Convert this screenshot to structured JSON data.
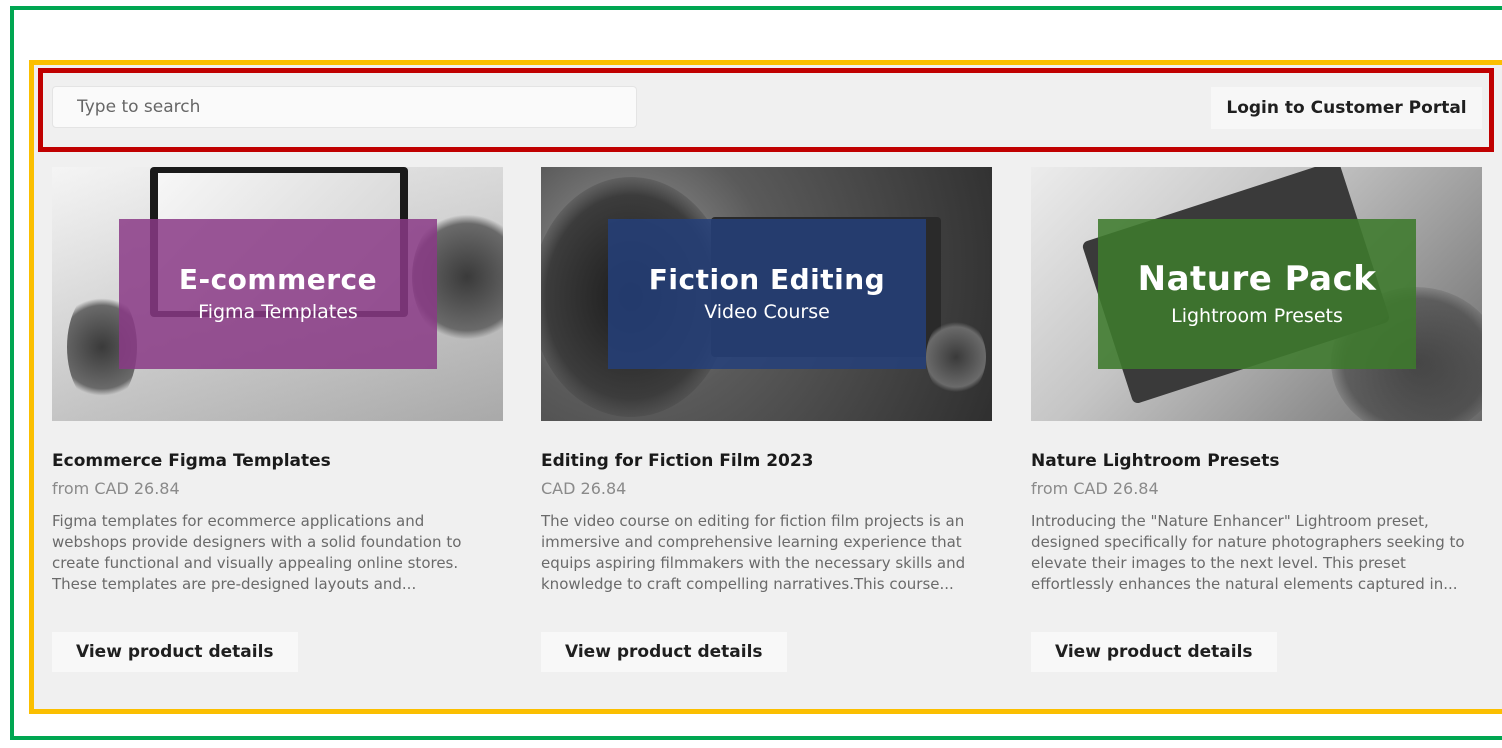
{
  "header": {
    "search_placeholder": "Type to search",
    "login_label": "Login to Customer Portal"
  },
  "products": [
    {
      "banner_title": "E-commerce",
      "banner_subtitle": "Figma Templates",
      "banner_color": "#8a3a86",
      "name": "Ecommerce Figma Templates",
      "price": "from CAD 26.84",
      "description": "Figma templates for ecommerce applications and webshops provide designers with a solid foundation to create functional and visually appealing online stores. These templates are pre-designed layouts and...",
      "button_label": "View product details"
    },
    {
      "banner_title": "Fiction Editing",
      "banner_subtitle": "Video Course",
      "banner_color": "#243f7a",
      "name": "Editing for Fiction Film 2023",
      "price": "CAD 26.84",
      "description": "The video course on editing for fiction film projects is an immersive and comprehensive learning experience that equips aspiring filmmakers with the necessary skills and knowledge to craft compelling narratives.This course...",
      "button_label": "View product details"
    },
    {
      "banner_title": "Nature Pack",
      "banner_subtitle": "Lightroom Presets",
      "banner_color": "#3d7a2c",
      "name": "Nature Lightroom Presets",
      "price": "from CAD 26.84",
      "description": "Introducing the \"Nature Enhancer\" Lightroom preset, designed specifically for nature photographers seeking to elevate their images to the next level. This preset effortlessly enhances the natural elements captured in...",
      "button_label": "View product details"
    }
  ]
}
